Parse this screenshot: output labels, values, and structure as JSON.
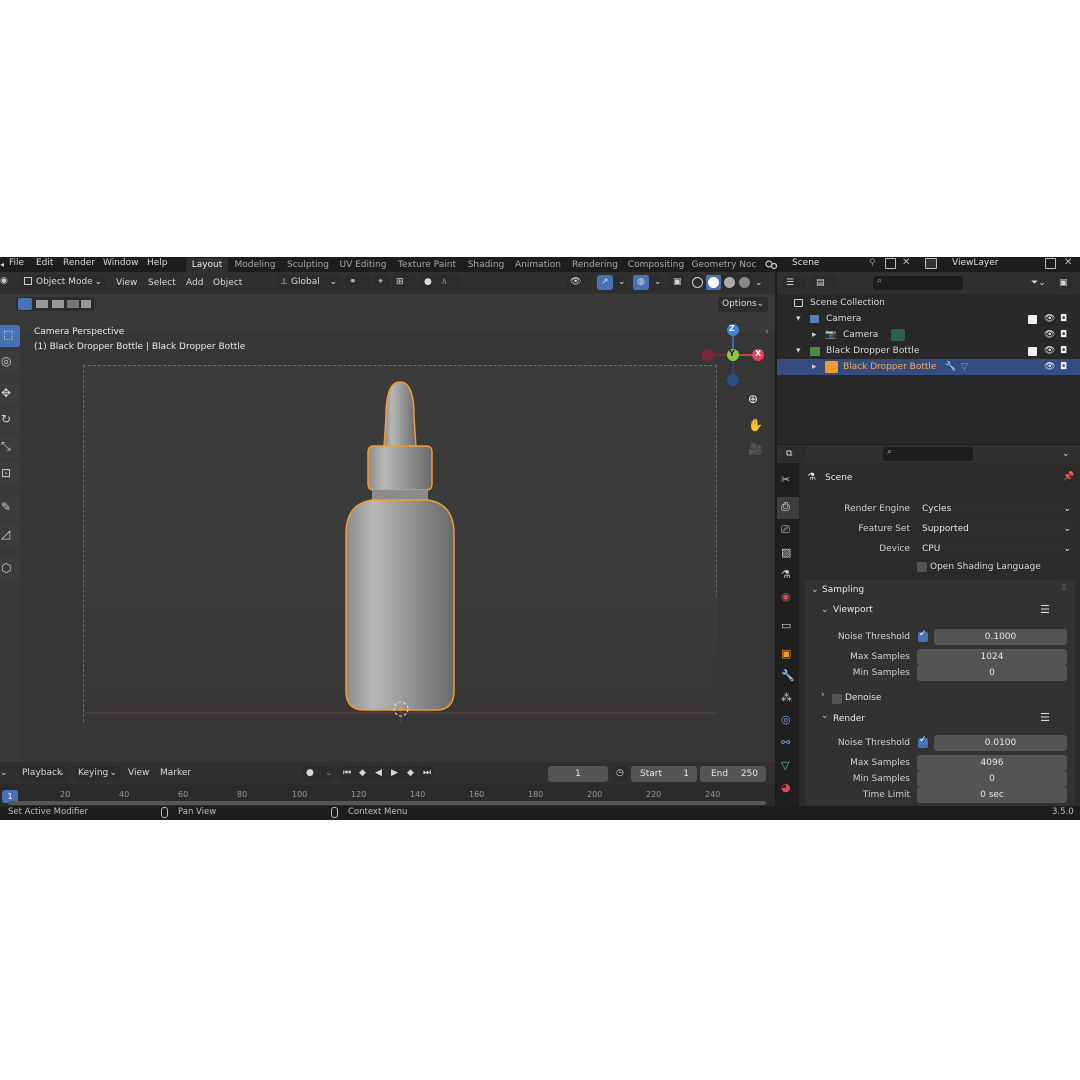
{
  "menu": [
    "File",
    "Edit",
    "Render",
    "Window",
    "Help"
  ],
  "workspaces": [
    "Layout",
    "Modeling",
    "Sculpting",
    "UV Editing",
    "Texture Paint",
    "Shading",
    "Animation",
    "Rendering",
    "Compositing",
    "Geometry Noc"
  ],
  "active_workspace": "Layout",
  "scene_name": "Scene",
  "view_layer": "ViewLayer",
  "viewport": {
    "mode": "Object Mode",
    "menus": [
      "View",
      "Select",
      "Add",
      "Object"
    ],
    "orientation": "Global",
    "options": "Options",
    "overlay_title": "Camera Perspective",
    "overlay_subtitle": "(1) Black Dropper Bottle | Black Dropper Bottle",
    "gizmo_axes": [
      "Z",
      "Y",
      "X"
    ]
  },
  "timeline": {
    "menus": [
      "Playback",
      "Keying",
      "View",
      "Marker"
    ],
    "current_frame": "1",
    "start_label": "Start",
    "start": "1",
    "end_label": "End",
    "end": "250",
    "ruler": [
      "1",
      "20",
      "40",
      "60",
      "80",
      "100",
      "120",
      "140",
      "160",
      "180",
      "200",
      "220",
      "240"
    ]
  },
  "status": {
    "left": "Set Active Modifier",
    "middle": "Pan View",
    "right": "Context Menu",
    "version": "3.5.0"
  },
  "outliner": {
    "rows": [
      {
        "label": "Scene Collection"
      },
      {
        "label": "Camera"
      },
      {
        "label": "Camera"
      },
      {
        "label": "Black Dropper Bottle"
      },
      {
        "label": "Black Dropper Bottle"
      }
    ]
  },
  "properties": {
    "header": "Scene",
    "render_engine_label": "Render Engine",
    "render_engine": "Cycles",
    "feature_set_label": "Feature Set",
    "feature_set": "Supported",
    "device_label": "Device",
    "device": "CPU",
    "osl_label": "Open Shading Language",
    "sampling": "Sampling",
    "viewport_section": "Viewport",
    "vp_noise_label": "Noise Threshold",
    "vp_noise": "0.1000",
    "vp_max_label": "Max Samples",
    "vp_max": "1024",
    "vp_min_label": "Min Samples",
    "vp_min": "0",
    "denoise": "Denoise",
    "render_section": "Render",
    "r_noise_label": "Noise Threshold",
    "r_noise": "0.0100",
    "r_max_label": "Max Samples",
    "r_max": "4096",
    "r_min_label": "Min Samples",
    "r_min": "0",
    "time_limit_label": "Time Limit",
    "time_limit": "0 sec"
  },
  "colors": {
    "accent": "#4772b3",
    "selection_outline": "#f29b2c",
    "axis_x": "#e2435a",
    "axis_y": "#8dc63f",
    "axis_z": "#3f7fd8"
  }
}
